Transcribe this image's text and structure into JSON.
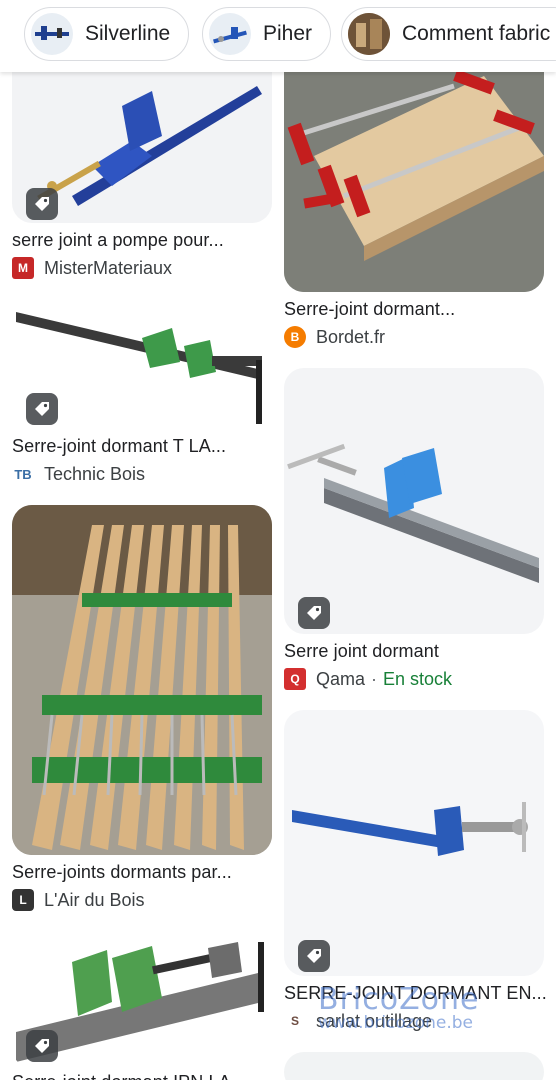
{
  "chips": [
    {
      "label": "Silverline",
      "icon": "clamp-thumbnail"
    },
    {
      "label": "Piher",
      "icon": "clamp-thumbnail"
    },
    {
      "label": "Comment fabric",
      "icon": "workshop-thumbnail"
    }
  ],
  "left_column": [
    {
      "title": "serre joint a pompe pour...",
      "source": "MisterMateriaux",
      "favicon": "M",
      "favicon_color": "#c62828"
    },
    {
      "title": "Serre-joint dormant T LA...",
      "source": "Technic Bois",
      "favicon": "TB",
      "favicon_color": "#3a6ea5"
    },
    {
      "title": "Serre-joints dormants par...",
      "source": "L'Air du Bois",
      "favicon": "L",
      "favicon_color": "#333333"
    },
    {
      "title": "Serre-joint dormant IPN LA",
      "source": "",
      "favicon": "",
      "favicon_color": ""
    }
  ],
  "right_column": [
    {
      "title": "Serre-joint dormant...",
      "source": "Bordet.fr",
      "favicon": "B",
      "favicon_color": "#f57c00"
    },
    {
      "title": "Serre joint dormant",
      "source": "Qama",
      "stock": "En stock",
      "favicon": "Q",
      "favicon_color": "#d32f2f"
    },
    {
      "title": "SERRE-JOINT DORMANT EN...",
      "source": "sarlat outillage",
      "favicon": "S",
      "favicon_color": "#6d4c41"
    }
  ],
  "watermark": {
    "brand": "BricoZone",
    "url": "www.bricozone.be"
  },
  "colors": {
    "accent_stock": "#188038",
    "chip_border": "#dadce0"
  }
}
